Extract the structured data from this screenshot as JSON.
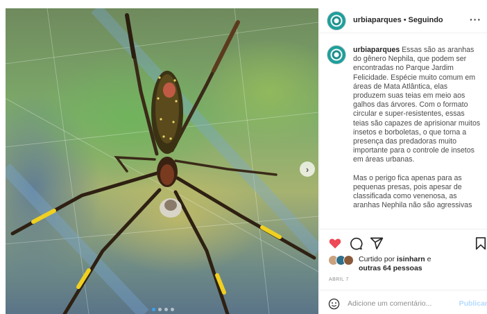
{
  "post": {
    "account": {
      "username": "urbiaparques",
      "separator": "•",
      "follow_status": "Seguindo",
      "more_label": "···"
    },
    "media": {
      "carousel_total": 4,
      "carousel_active": 1,
      "next_glyph": "›"
    },
    "caption": {
      "username": "urbiaparques",
      "paragraph_1": " Essas são as aranhas do gênero Nephila, que podem ser encontradas no Parque Jardim Felicidade. Espécie muito comum em áreas de Mata Atlântica, elas produzem suas teias em meio aos galhos das árvores. Com o formato circular e super-resistentes, essas teias são capazes de aprisionar muitos insetos e borboletas, o que torna a presença das predadoras muito importante para o controle de insetos em áreas urbanas.",
      "paragraph_2": "Mas o perigo fica apenas para as pequenas presas, pois apesar de classificada como venenosa, as aranhas Nephila não são agressivas"
    },
    "actions": {
      "icons": [
        "heart-icon",
        "comment-icon",
        "share-icon",
        "bookmark-icon"
      ],
      "liked": true,
      "like_color": "#ed4956"
    },
    "likes": {
      "prefix": "Curtido por ",
      "user": "isinharn",
      "conjunction": " e",
      "others": "outras 64 pessoas"
    },
    "date": "ABRIL 7",
    "comment": {
      "placeholder": "Adicione um comentário...",
      "publish_label": "Publicar",
      "publish_color": "#b3dbff"
    }
  }
}
